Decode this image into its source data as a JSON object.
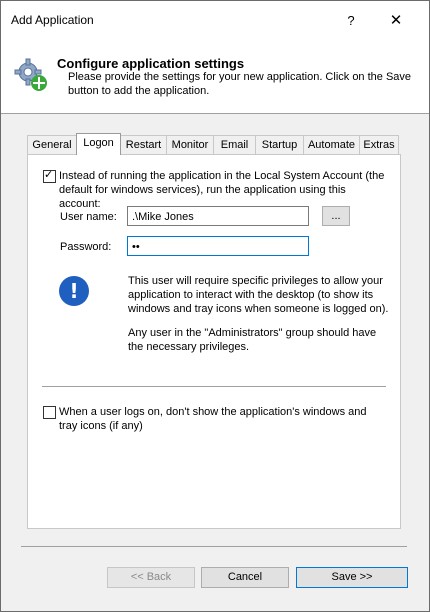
{
  "window": {
    "title": "Add Application",
    "help_label": "?",
    "close_label": "✕"
  },
  "header": {
    "title": "Configure application settings",
    "description": "Please provide the settings for your new application. Click on the Save button to add the application."
  },
  "tabs": [
    {
      "label": "General"
    },
    {
      "label": "Logon"
    },
    {
      "label": "Restart"
    },
    {
      "label": "Monitor"
    },
    {
      "label": "Email"
    },
    {
      "label": "Startup"
    },
    {
      "label": "Automate"
    },
    {
      "label": "Extras"
    }
  ],
  "active_tab": "Logon",
  "logon": {
    "run_as_checkbox": {
      "checked": true,
      "label": "Instead of running the application in the Local System Account (the default for windows services), run the application using this account:"
    },
    "username_label": "User name:",
    "username_value": ".\\Mike Jones",
    "browse_label": "...",
    "password_label": "Password:",
    "password_value": "••",
    "info_text_1": "This user will require specific privileges to allow your application to interact with the desktop (to show its windows and tray icons when someone is logged on).",
    "info_text_2": "Any user in the \"Administrators\" group should have the necessary privileges.",
    "hide_windows_checkbox": {
      "checked": false,
      "label": "When a user logs on, don't show the application's windows and tray icons (if any)"
    }
  },
  "buttons": {
    "back": "<< Back",
    "cancel": "Cancel",
    "save": "Save >>"
  },
  "colors": {
    "accent": "#0078d7",
    "info_icon": "#1f5fbf"
  }
}
